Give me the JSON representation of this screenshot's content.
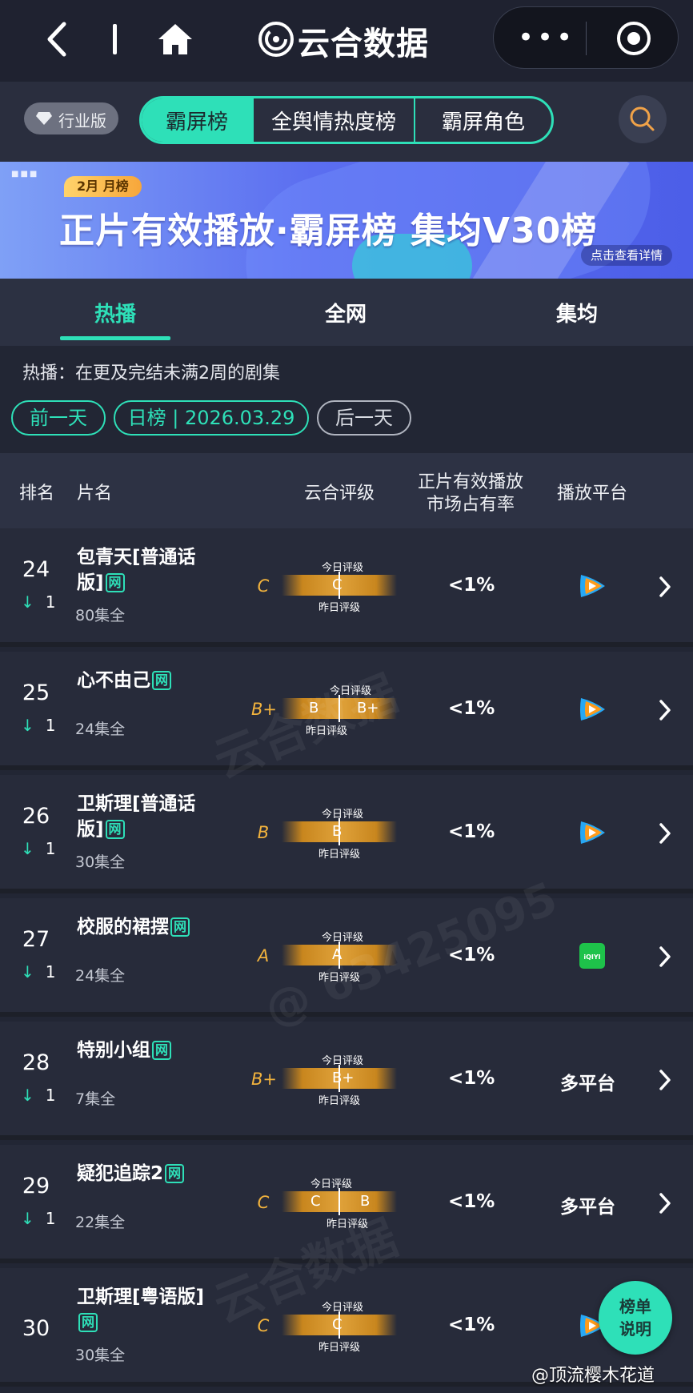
{
  "app": {
    "title": "云合数据"
  },
  "filter": {
    "industry_badge": "行业版",
    "segments": [
      "霸屏榜",
      "全舆情热度榜",
      "霸屏角色"
    ]
  },
  "banner": {
    "month_tag": "2月 月榜",
    "title": "正片有效播放·霸屏榜 集均V30榜",
    "detail": "点击查看详情"
  },
  "tabs": [
    "热播",
    "全网",
    "集均"
  ],
  "description": "热播：在更及完结未满2周的剧集",
  "date_pills": {
    "prev": "前一天",
    "current": "日榜 | 2026.03.29",
    "next": "后一天"
  },
  "table_header": {
    "rank": "排名",
    "name": "片名",
    "rating": "云合评级",
    "share_line1": "正片有效播放",
    "share_line2": "市场占有率",
    "platform": "播放平台"
  },
  "rating_labels": {
    "today": "今日评级",
    "yesterday": "昨日评级"
  },
  "rows": [
    {
      "rank": "24",
      "change": "1",
      "title": "包青天[普通话版]",
      "net": "网",
      "episodes": "80集全",
      "grade": "C",
      "yesterday_grade": "C",
      "today_grade": "C",
      "share": "<1%",
      "platform": "腾讯视频",
      "platform_icon": "tencent-video-icon"
    },
    {
      "rank": "25",
      "change": "1",
      "title": "心不由己",
      "net": "网",
      "episodes": "24集全",
      "grade": "B+",
      "yesterday_grade": "B",
      "today_grade": "B+",
      "share": "<1%",
      "platform": "腾讯视频",
      "platform_icon": "tencent-video-icon"
    },
    {
      "rank": "26",
      "change": "1",
      "title": "卫斯理[普通话版]",
      "net": "网",
      "episodes": "30集全",
      "grade": "B",
      "yesterday_grade": "B",
      "today_grade": "B",
      "share": "<1%",
      "platform": "腾讯视频",
      "platform_icon": "tencent-video-icon"
    },
    {
      "rank": "27",
      "change": "1",
      "title": "校服的裙摆",
      "net": "网",
      "episodes": "24集全",
      "grade": "A",
      "yesterday_grade": "A",
      "today_grade": "A",
      "share": "<1%",
      "platform": "iQIYI",
      "platform_icon": "iqiyi-icon"
    },
    {
      "rank": "28",
      "change": "1",
      "title": "特别小组",
      "net": "网",
      "episodes": "7集全",
      "grade": "B+",
      "yesterday_grade": "B+",
      "today_grade": "B+",
      "share": "<1%",
      "platform": "多平台",
      "platform_icon": ""
    },
    {
      "rank": "29",
      "change": "1",
      "title": "疑犯追踪2",
      "net": "网",
      "episodes": "22集全",
      "grade": "C",
      "yesterday_grade": "B",
      "today_grade": "C",
      "share": "<1%",
      "platform": "多平台",
      "platform_icon": ""
    },
    {
      "rank": "30",
      "change": "",
      "title": "卫斯理[粤语版]",
      "net": "网",
      "episodes": "30集全",
      "grade": "C",
      "yesterday_grade": "C",
      "today_grade": "C",
      "share": "<1%",
      "platform": "腾讯视频",
      "platform_icon": "tencent-video-icon"
    }
  ],
  "float_button": {
    "line1": "榜单",
    "line2": "说明"
  },
  "weibo_watermark": "@顶流樱木花道",
  "colors": {
    "accent": "#2ee0b8",
    "grade": "#f2b33d",
    "background": "#222634"
  }
}
